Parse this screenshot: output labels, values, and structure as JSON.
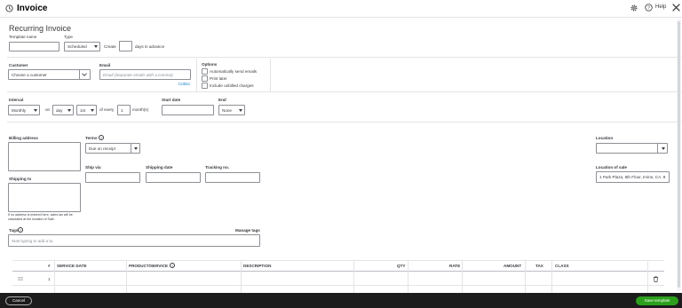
{
  "header": {
    "title": "Invoice",
    "help_label": "Help"
  },
  "form": {
    "heading": "Recurring Invoice",
    "template_name_label": "Template name",
    "template_name_value": "",
    "type_label": "Type",
    "type_value": "Scheduled",
    "create_label": "Create",
    "create_days_value": "",
    "days_in_advance_label": "days in advance",
    "customer_label": "Customer",
    "customer_placeholder": "Choose a customer",
    "email_label": "Email",
    "email_placeholder": "Email (Separate emails with a comma)",
    "cc_bcc_label": "Cc/Bcc",
    "options_label": "Options",
    "options": [
      {
        "label": "Automatically send emails",
        "checked": false
      },
      {
        "label": "Print later",
        "checked": false
      },
      {
        "label": "Include unbilled charges",
        "checked": false
      }
    ],
    "interval_label": "Interval",
    "interval_value": "Monthly",
    "on_label": "on",
    "on_value": "day",
    "day_value": "1st",
    "of_every_label": "of every",
    "every_value": "1",
    "months_label": "month(s)",
    "start_date_label": "Start date",
    "start_date_value": "",
    "end_label": "End",
    "end_value": "None",
    "billing_address_label": "Billing address",
    "terms_label": "Terms",
    "terms_value": "Due on receipt",
    "location_label": "Location",
    "location_value": "",
    "ship_via_label": "Ship via",
    "shipping_date_label": "Shipping date",
    "tracking_no_label": "Tracking no.",
    "location_of_sale_label": "Location of sale",
    "location_of_sale_value": "1 Park Plaza, 6th Floor, Irvine, CA, 9",
    "shipping_to_label": "Shipping to",
    "tax_note": "If no address is entered here, sales tax will be calculated at the location of Sale.",
    "tags_label": "Tags",
    "manage_tags_label": "Manage tags",
    "tags_placeholder": "Start typing to add a ta"
  },
  "table": {
    "columns": [
      "#",
      "SERVICE DATE",
      "PRODUCT/SERVICE",
      "DESCRIPTION",
      "QTY",
      "RATE",
      "AMOUNT",
      "TAX",
      "CLASS"
    ],
    "rows": [
      {
        "num": "1"
      }
    ]
  },
  "footer": {
    "cancel_label": "Cancel",
    "save_label": "Save template"
  },
  "colors": {
    "accent_green": "#2ca01c",
    "footer_bg": "#1c1c1c",
    "border": "#8d9096"
  }
}
